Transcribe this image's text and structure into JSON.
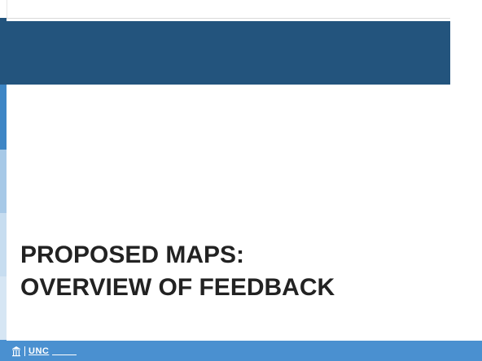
{
  "slide": {
    "title_lines": [
      "PROPOSED MAPS:",
      "OVERVIEW OF FEEDBACK"
    ]
  },
  "footer": {
    "logo_text": "UNC",
    "logo_icon": "old-well-icon"
  },
  "colors": {
    "title_bar": "#23547d",
    "footer_bar": "#4a90d0",
    "title_text": "#222222"
  }
}
